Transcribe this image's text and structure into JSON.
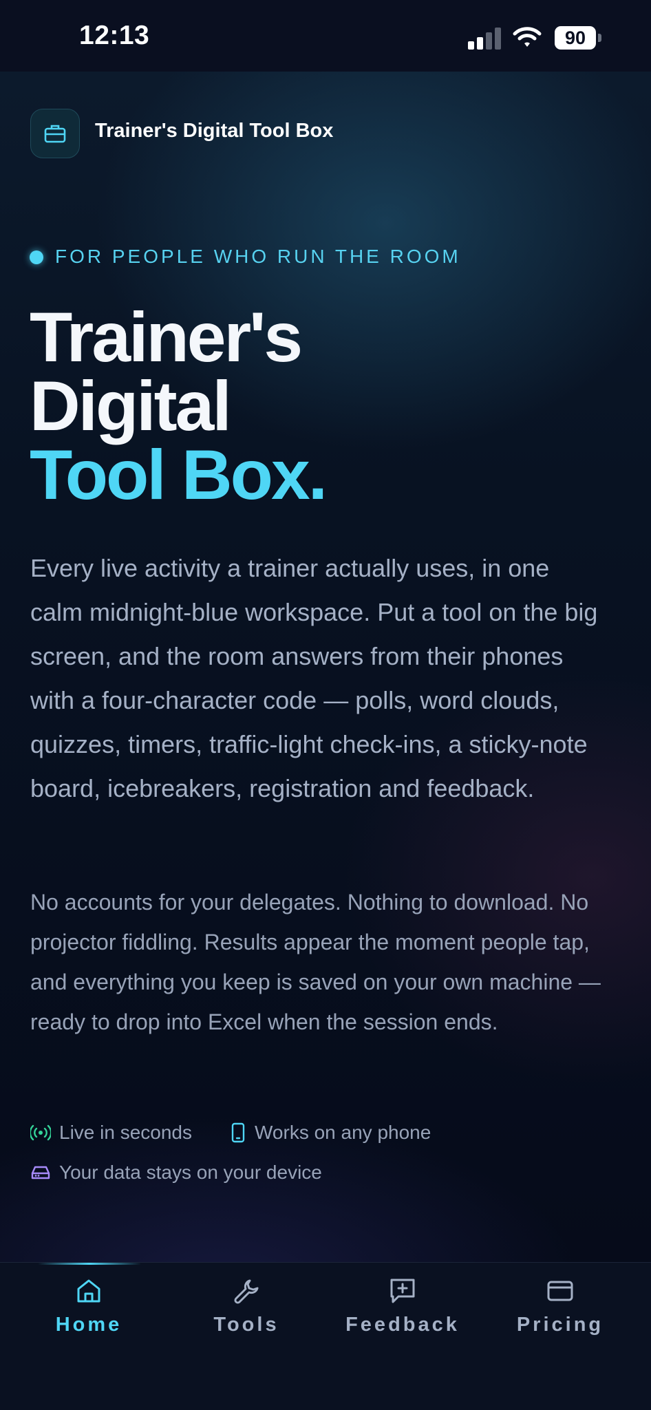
{
  "status_bar": {
    "time": "12:13",
    "battery": "90"
  },
  "brand": {
    "name": "Trainer's Digital Tool Box",
    "icon": "toolbox-icon"
  },
  "hero": {
    "eyebrow": "FOR PEOPLE WHO RUN THE ROOM",
    "title_line1": "Trainer's",
    "title_line2": "Digital",
    "title_accent": "Tool Box.",
    "lead": "Every live activity a trainer actually uses, in one calm midnight-blue workspace. Put a tool on the big screen, and the room answers from their phones with a four-character code — polls, word clouds, quizzes, timers, traffic-light check-ins, a sticky-note board, icebreakers, registration and feedback.",
    "body": "No accounts for your delegates. Nothing to download. No projector fiddling. Results appear the moment people tap, and everything you keep is saved on your own machine — ready to drop into Excel when the session ends."
  },
  "features": [
    {
      "label": "Live in seconds",
      "icon": "broadcast-icon",
      "color": "#34d399"
    },
    {
      "label": "Works on any phone",
      "icon": "phone-icon",
      "color": "#4fd6f5"
    },
    {
      "label": "Your data stays on your device",
      "icon": "drive-icon",
      "color": "#a78bfa"
    }
  ],
  "tabs": [
    {
      "label": "Home",
      "icon": "home-icon",
      "active": true
    },
    {
      "label": "Tools",
      "icon": "wrench-icon",
      "active": false
    },
    {
      "label": "Feedback",
      "icon": "feedback-icon",
      "active": false
    },
    {
      "label": "Pricing",
      "icon": "credit-card-icon",
      "active": false
    }
  ],
  "colors": {
    "accent": "#4fd6f5",
    "background": "#060a18",
    "text_muted": "#a5b1c6"
  }
}
